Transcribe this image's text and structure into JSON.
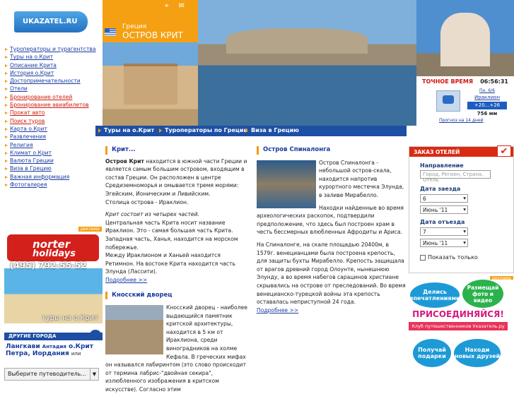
{
  "logo": "UKAZATEL.RU",
  "header": {
    "country": "Греция",
    "title": "ОСТРОВ КРИТ"
  },
  "nav": [
    "Туроператоры и турагентства",
    "Туры на о.Крит",
    "Описание Крита",
    "История о.Крит",
    "Достопримечательности",
    "Отели",
    "Бронирование отелей",
    "Бронирование авиабилетов",
    "Прокат авто",
    "Поиск туров",
    "Карта о.Крит",
    "Развлечения",
    "Религия",
    "Климат о.Крит",
    "Валюта Греции",
    "Виза в Грецию",
    "Важная информация",
    "Фотогалерея"
  ],
  "nav_red": [
    6,
    7,
    8,
    9
  ],
  "weather": {
    "label": "ТОЧНОЕ ВРЕМЯ",
    "time": "06:56:31",
    "date": "Пн. 6/6",
    "city": "Ираклион",
    "temp": "+20...+26",
    "pressure": "756 мм",
    "forecast": "Прогноз на 14 дней"
  },
  "topnav": [
    "Туры на о.Крит",
    "Туроператоры по Греции",
    "Виза в Грецию"
  ],
  "ad": {
    "label": "реклама",
    "brand": "norter",
    "brand2": "holidays",
    "phone": "(495) 792-55-52",
    "caption": "туры на о.Крит"
  },
  "cities": {
    "title": "ДРУГИЕ ГОРОДА",
    "c1": "Лангкави",
    "c1b": "Антадия",
    "c2": "о.Крит",
    "c3": "Петра, Иордания",
    "c3b": "или",
    "guide": "Выберите путеводитель..."
  },
  "crete": {
    "title": "Крит...",
    "lead": "Остров Крит",
    "p1": " находится в южной части Греции и является самым большим островом, входящим в состав Греции. Он расположен в центре Средиземноморья и омывается тремя морями: Эгейским, Ионическим и Ливийским.",
    "p2": "Столица острова - Ираклион.",
    "p3": "Крит состоит из четырех частей.",
    "p4": "Центральная часть Крита носит название Ираклион. Это - самая большая часть Крита.",
    "p5": "Западная часть, Ханья, находится на морском побережье.",
    "p6": "Между Ираклионом и Ханьей находится Ретимнон. На востоке Крита находится часть Элунда (Лассити).",
    "more": "Подробнее >>"
  },
  "knossos": {
    "title": "Кносский дворец",
    "p1": "Кносский дворец - наиболее выдающийся памятник критской архитектуры, находится в 5 км от Ираклиона, среди виноградников на холме Кефала. В греческих мифах он назывался лабиринтом (это слово происходит от термина лабрис-\"двойная секира\", излюбленного изображения в критском искусстве). Согласно этим"
  },
  "spinalonga": {
    "title": "Остров Спиналонга",
    "p1": "Остров Спиналонга - небольшой остров-скала, находится напротив курортного местечка Элунда, в заливе Мирабелло.",
    "p2": "Находки найденные во время археологических раскопок, подтвердили предположение, что здесь был построен храм в честь бессмерных влюбленных Афродиты и Ариса.",
    "p3": "На Спиналонге, на скале площадью 20400м, в 1579г. венецианцами была построена крепость, для защиты бухты Мирабелло. Крепость защищала от врагов древний город Олоунте, нынешнюю Элунду, а во время набегов сарацинов христиане скрывались на острове от преследований. Во время венецианско-турецкой войны эта крепость оставалась неприступной 24 года.",
    "more": "Подробнее >>"
  },
  "hotel": {
    "title": "ЗАКАЗ ОТЕЛЕЙ",
    "dest_label": "Направление",
    "dest_ph": "Город, Регион, Страна, Отель",
    "in_label": "Дата заезда",
    "in_day": "6",
    "in_month": "Июнь '11",
    "out_label": "Дата отъезда",
    "out_day": "7",
    "out_month": "Июнь '11",
    "only": "Показать только"
  },
  "banner": {
    "b1": "Делись впечатлениями",
    "b2": "Размещай фото и видео",
    "join": "ПРИСОЕДИНЯЙСЯ!",
    "club": "Клуб путешественников Указатель.ру",
    "b3": "Получай подарки",
    "b4": "Находи новых друзей",
    "label": "реклама"
  }
}
